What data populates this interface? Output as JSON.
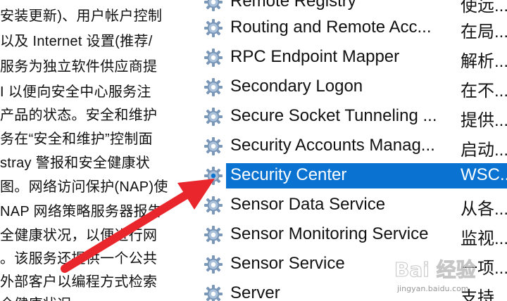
{
  "description_pane": {
    "lines": [
      "安装更新)、用户帐户控制",
      "以及 Internet 设置(推荐/",
      "服务为独立软件供应商提",
      "I 以便向安全中心服务注",
      "产品的状态。安全和维护",
      "务在“安全和维护”控制面",
      "stray 警报和安全健康状",
      "图。网络访问保护(NAP)使",
      "NAP 网络策略服务器报告",
      "全健康状况，以便进行网",
      "。该服务还提供一个公共",
      "外部客户以编程方式检索",
      "全健康状况"
    ]
  },
  "services": [
    {
      "name": "Remote Registry",
      "description": "使远..."
    },
    {
      "name": "Routing and Remote Acc...",
      "description": "在局..."
    },
    {
      "name": "RPC Endpoint Mapper",
      "description": "解析..."
    },
    {
      "name": "Secondary Logon",
      "description": "在不..."
    },
    {
      "name": "Secure Socket Tunneling ...",
      "description": "提供..."
    },
    {
      "name": "Security Accounts Manag...",
      "description": "启动..."
    },
    {
      "name": "Security Center",
      "description": "WSC...",
      "selected": true
    },
    {
      "name": "Sensor Data Service",
      "description": "从各..."
    },
    {
      "name": "Sensor Monitoring Service",
      "description": "监视..."
    },
    {
      "name": "Sensor Service",
      "description": "一项..."
    },
    {
      "name": "Server",
      "description": "支持..."
    }
  ],
  "colors": {
    "selection": "#0a73d1",
    "arrow": "#e8262b",
    "gear": "#7a97b8"
  },
  "watermark": {
    "brand": "Bai 经验",
    "url": "jingyan.baidu.com"
  }
}
